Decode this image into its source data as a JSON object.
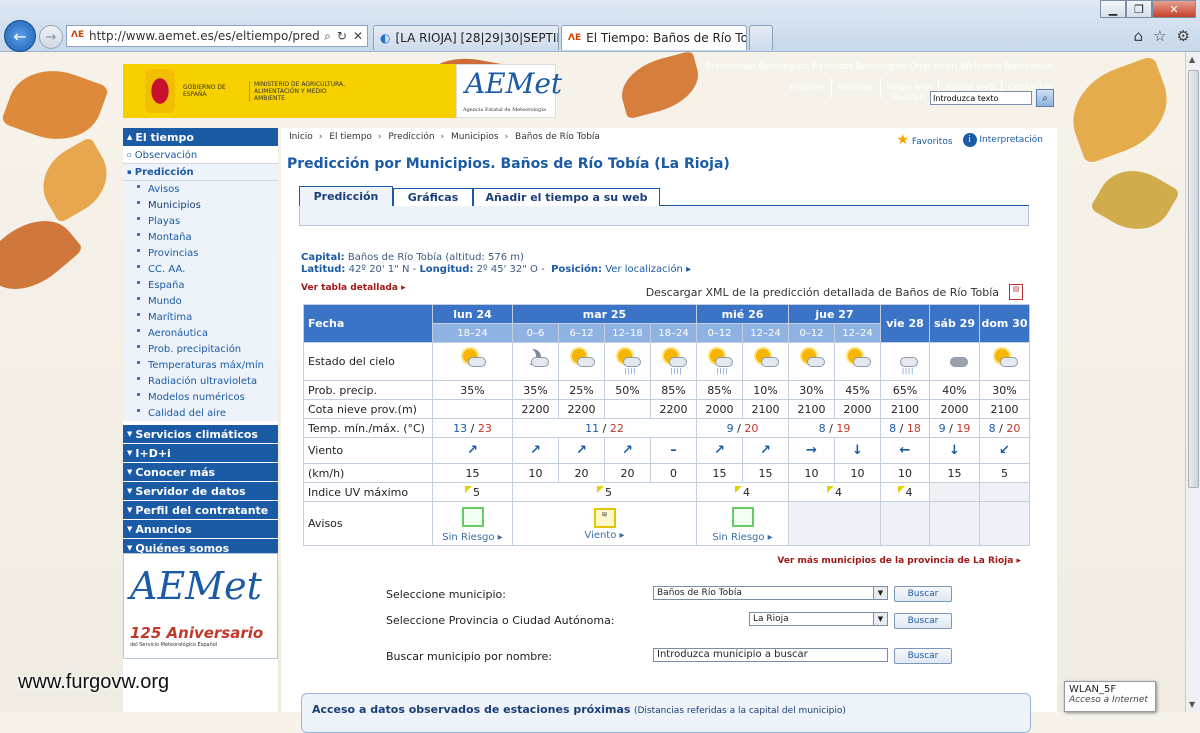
{
  "browser": {
    "url": "http://www.aemet.es/es/eltiempo/pred",
    "tabs": [
      {
        "label": "[LA RIOJA] [28|29|30|SEPTIEMB..."
      },
      {
        "label": "El Tiempo: Baños de Río To..."
      }
    ]
  },
  "header": {
    "gov": "GOBIERNO DE ESPAÑA",
    "ministry": "MINISTERIO DE AGRICULTURA, ALIMENTACIÓN Y MEDIO AMBIENTE",
    "logo": "AEMet",
    "logo_sub": "Agencia Estatal de Meteorología",
    "welcome": "Bienvenido Benvinguts Benvidos Benvinguts Ongi etorri Welcome Bienvenue",
    "links": [
      "Enlaces",
      "Noticias",
      "Mapa web",
      "Ayuda web",
      "Contactar"
    ],
    "search_label": "Buscar:",
    "search_placeholder": "Introduzca texto"
  },
  "sidebar": {
    "sections_top": "El tiempo",
    "observacion": "Observación",
    "prediccion": "Predicción",
    "items": [
      "Avisos",
      "Municipios",
      "Playas",
      "Montaña",
      "Provincias",
      "CC. AA.",
      "España",
      "Mundo",
      "Marítima",
      "Aeronáutica",
      "Prob. precipitación",
      "Temperaturas máx/mín",
      "Radiación ultravioleta",
      "Modelos numéricos",
      "Calidad del aire"
    ],
    "sections": [
      "Servicios climáticos",
      "I+D+i",
      "Conocer más",
      "Servidor de datos",
      "Perfil del contratante",
      "Anuncios",
      "Quiénes somos"
    ],
    "anniv_logo": "AEMet",
    "anniv_text": "125 Aniversario",
    "anniv_sub": "del Servicio Meteorológico Español"
  },
  "watermark": "www.furgovw.org",
  "main": {
    "breadcrumb": [
      "Inicio",
      "El tiempo",
      "Predicción",
      "Municipios",
      "Baños de Río Tobía"
    ],
    "favoritos": "Favoritos",
    "interpretacion": "Interpretación",
    "title": "Predicción por Municipios. Baños de Río Tobía (La Rioja)",
    "tabs": [
      "Predicción",
      "Gráficas",
      "Añadir el tiempo a su web"
    ],
    "capital_label": "Capital:",
    "capital_value": "Baños de Río Tobía (altitud: 576 m)",
    "lat_label": "Latitud:",
    "lat_value": "42º 20' 1\" N",
    "lon_label": "Longitud:",
    "lon_value": "2º 45' 32\" O",
    "pos_label": "Posición:",
    "pos_link": "Ver localización",
    "ver_tabla": "Ver tabla detallada",
    "xml_link": "Descargar XML de la predicción detallada de Baños de Río Tobía",
    "ver_mas": "Ver más municipios de la provincia de La Rioja",
    "form": {
      "municipio_label": "Seleccione municipio:",
      "municipio_value": "Baños de Río Tobía",
      "provincia_label": "Seleccione Provincia o Ciudad Autónoma:",
      "provincia_value": "La Rioja",
      "buscar_label": "Buscar municipio por nombre:",
      "buscar_value": "Introduzca municipio a buscar",
      "button": "Buscar"
    },
    "bottom_title": "Acceso a datos observados de estaciones próximas",
    "bottom_note": "(Distancias referidas a la capital del municipio)"
  },
  "forecast": {
    "row_labels": {
      "fecha": "Fecha",
      "cielo": "Estado del cielo",
      "precip": "Prob. precip.",
      "nieve": "Cota nieve prov.(m)",
      "temp": "Temp. mín./máx. (°C)",
      "viento": "Viento",
      "kmh": "(km/h)",
      "uv": "Indice UV máximo",
      "avisos": "Avisos"
    },
    "days": [
      {
        "label": "lun 24",
        "periods": [
          "18–24"
        ]
      },
      {
        "label": "mar 25",
        "periods": [
          "0–6",
          "6–12",
          "12–18",
          "18–24"
        ]
      },
      {
        "label": "mié 26",
        "periods": [
          "0–12",
          "12–24"
        ]
      },
      {
        "label": "jue 27",
        "periods": [
          "0–12",
          "12–24"
        ]
      },
      {
        "label": "vie 28",
        "periods": []
      },
      {
        "label": "sáb 29",
        "periods": []
      },
      {
        "label": "dom 30",
        "periods": []
      }
    ],
    "sky": [
      "sun-cloud",
      "moon-cloud",
      "sun-cloud",
      "sun-cloud-rain",
      "sun-cloud-rain",
      "sun-cloud-rain",
      "sun-cloud",
      "sun-cloud",
      "sun-cloud",
      "cloud-rain",
      "dark-cloud",
      "sun-cloud"
    ],
    "precip": [
      "35%",
      "35%",
      "25%",
      "50%",
      "85%",
      "85%",
      "10%",
      "30%",
      "45%",
      "65%",
      "40%",
      "30%"
    ],
    "nieve": [
      "",
      "2200",
      "2200",
      "",
      "2200",
      "2000",
      "2100",
      "2100",
      "2000",
      "2100",
      "2000",
      "2100"
    ],
    "temps": [
      {
        "min": "13",
        "max": "23"
      },
      {
        "min": "11",
        "max": "22"
      },
      {
        "min": "9",
        "max": "20"
      },
      {
        "min": "8",
        "max": "19"
      },
      {
        "min": "8",
        "max": "18"
      },
      {
        "min": "9",
        "max": "19"
      },
      {
        "min": "8",
        "max": "20"
      }
    ],
    "wind_dir": [
      "↗",
      "↗",
      "↗",
      "↗",
      "–",
      "↗",
      "↗",
      "→",
      "↓",
      "←",
      "↓",
      "↙"
    ],
    "wind_speed": [
      "15",
      "10",
      "20",
      "20",
      "0",
      "15",
      "15",
      "10",
      "10",
      "10",
      "15",
      "5"
    ],
    "uv": [
      "5",
      "5",
      "4",
      "4",
      "4"
    ],
    "avisos": [
      {
        "text": "Sin Riesgo"
      },
      {
        "text": "Viento"
      },
      {
        "text": "Sin Riesgo"
      }
    ]
  },
  "wlan": {
    "name": "WLAN_5F",
    "status": "Acceso a Internet"
  }
}
